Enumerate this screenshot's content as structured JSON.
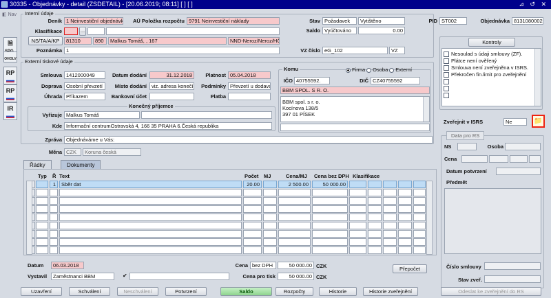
{
  "window": {
    "title": "30335 - Objednávky - detail (ZSDETAIL) - [20.06.2019; 08:11]  [ ]  [ ]",
    "controls": "⊿ ↺ ✕",
    "nav": "Nav"
  },
  "side_buttons": [
    "SPG",
    "OHOLV",
    "RP",
    "RP",
    "IR"
  ],
  "interni": {
    "title": "Interní údaje",
    "denik_label": "Deník",
    "denik_value": "1 Neinvestiční objednávky",
    "au_label": "AÚ Položka rozpočtu",
    "au_value": "9791 Neinvestiční náklady",
    "klasifikace_label": "Klasifikace",
    "ns_button": "NS/TA/A/KP",
    "ns_v1": "81310",
    "ns_v2": "890",
    "ns_v3": "Malkus Tomáš, , 167",
    "ns_v4": "NND-Neroz/Neroz/HČ-",
    "poznamka_label": "Poznámka",
    "poznamka_value": "1",
    "stav_label": "Stav",
    "stav_v1": "Požadavek",
    "stav_v2": "Vytištěno",
    "saldo_label": "Saldo",
    "saldo_v1": "Vyúčtováno",
    "saldo_v2": "0.00",
    "pid_label": "PID",
    "pid_value": "ST002",
    "obj_label": "Objednávka",
    "obj_value": "8131080002",
    "vz_label": "VZ číslo",
    "vz_value": "eG_102",
    "vz_suffix": "VZ"
  },
  "externi": {
    "title": "Externí tiskové údaje",
    "smlouva_label": "Smlouva",
    "smlouva_value": "1412000049",
    "datum_dodani_label": "Datum dodání",
    "datum_dodani_value": "31.12.2018",
    "platnost_label": "Platnost",
    "platnost_value": "05.04.2018",
    "doprava_label": "Doprava",
    "doprava_value": "Osobní převzetí",
    "misto_label": "Místo dodání",
    "misto_value": "viz. adresa konečí",
    "podminky_label": "Podmínky",
    "podminky_value": "Převzetí u dodava",
    "uhrada_label": "Úhrada",
    "uhrada_value": "Příkazem",
    "bank_label": "Bankovní účet",
    "platba_label": "Platba",
    "konecny_title": "Konečný příjemce",
    "vyrizuje_label": "Vyřizuje",
    "vyrizuje_value": "Malkus Tomáš",
    "kde_label": "Kde",
    "kde_value": "Informační centrumOstravská 4, 166 35 PRAHA 6.Česká republika",
    "zprava_label": "Zpráva",
    "zprava_value": "Objednáváme u Vás:",
    "mena_label": "Měna",
    "mena_code": "CZK",
    "mena_name": "Koruna česká"
  },
  "komu": {
    "title": "Komu",
    "firma": "Firma",
    "osoba": "Osoba",
    "externi": "Externí",
    "ico_label": "IČO",
    "ico_value": "40755592.",
    "dic_label": "DIČ",
    "dic_value": "CZ40755592",
    "name": "BBM SPOL. S R. O.",
    "addr1": "BBM spol. s r. o.",
    "addr2": "Kocínova 138/5",
    "addr3": "397 01  PÍSEK"
  },
  "kontroly": {
    "button": "Kontroly",
    "items": [
      "Nesoulad s údaji smlouvy (ZF).",
      "Plátce není ověřený",
      "Smlouva není zveřejněna v ISRS.",
      "Překročen fin.limit pro zveřejnění"
    ],
    "zverejnit_label": "Zveřejnit v ISRS",
    "zverejnit_value": "Ne"
  },
  "rs": {
    "title": "Data pro RS",
    "ns_label": "NS",
    "osoba_label": "Osoba",
    "cena_label": "Cena",
    "datum_label": "Datum potvrzení",
    "predmet_label": "Předmět",
    "cislo_label": "Číslo smlouvy",
    "stav_label": "Stav zveř."
  },
  "tabs": [
    "Řádky",
    "Dokumenty"
  ],
  "grid": {
    "headers": [
      "Typ",
      "Ř",
      "Text",
      "Počet",
      "MJ",
      "Cena/MJ",
      "Cena bez DPH",
      "Klasifikace"
    ],
    "rows": [
      {
        "typ": "",
        "r": "1",
        "text": "Sběr dat",
        "pocet": "20.00",
        "mj": "",
        "cena_mj": "2 500.00",
        "cena_bez": "50 000.00",
        "klas": ""
      }
    ]
  },
  "footer": {
    "datum_label": "Datum",
    "datum_value": "06.03.2018",
    "vystavil_label": "Vystavil",
    "vystavil_value": "Zaměstnanci BBM",
    "check": "✔",
    "cena_label": "Cena",
    "cena_typ": "bez DPH",
    "cena_value": "50 000.00",
    "cena_cur": "CZK",
    "cena_tisk_label": "Cena pro tisk",
    "cena_tisk_value": "50 000.00",
    "cena_tisk_cur": "CZK",
    "prepocet": "Přepočet"
  },
  "buttons": [
    "Uzavření",
    "Schválení",
    "Neschválení",
    "Potvrzení",
    "Saldo",
    "Rozpočty",
    "Historie",
    "Historie zveřejnění",
    "Odeslat ke zveřejnění do RS"
  ]
}
